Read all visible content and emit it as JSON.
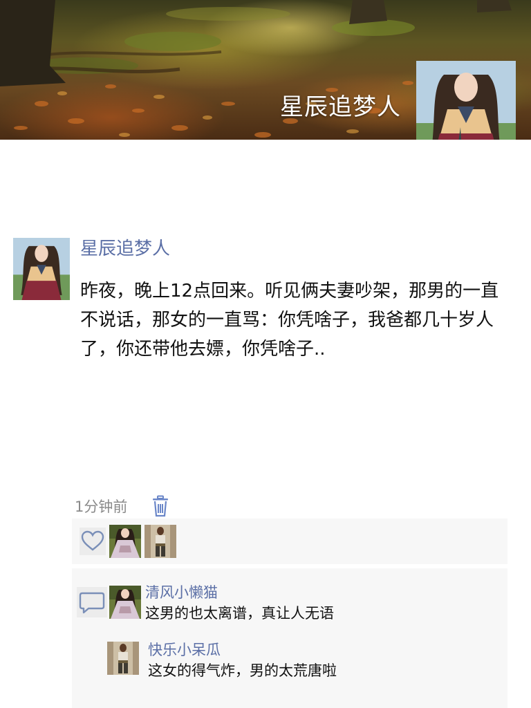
{
  "profile": {
    "display_name": "星辰追梦人"
  },
  "post": {
    "author": "星辰追梦人",
    "content": "昨夜，晚上12点回来。听见俩夫妻吵架，那男的一直不说话，那女的一直骂：你凭啥子，我爸都几十岁人了，你还带他去嫖，你凭啥子..",
    "time": "1分钟前"
  },
  "comments": [
    {
      "author": "清风小懒猫",
      "text": "这男的也太离谱，真让人无语"
    },
    {
      "author": "快乐小呆瓜",
      "text": "这女的得气炸，男的太荒唐啦"
    }
  ],
  "icons": {
    "like": "heart-outline-icon",
    "comment": "speech-bubble-icon",
    "delete": "trash-icon"
  },
  "colors": {
    "link_blue": "#5b6fa6",
    "meta_gray": "#8a8a8a",
    "box_bg": "#f7f7f7"
  }
}
